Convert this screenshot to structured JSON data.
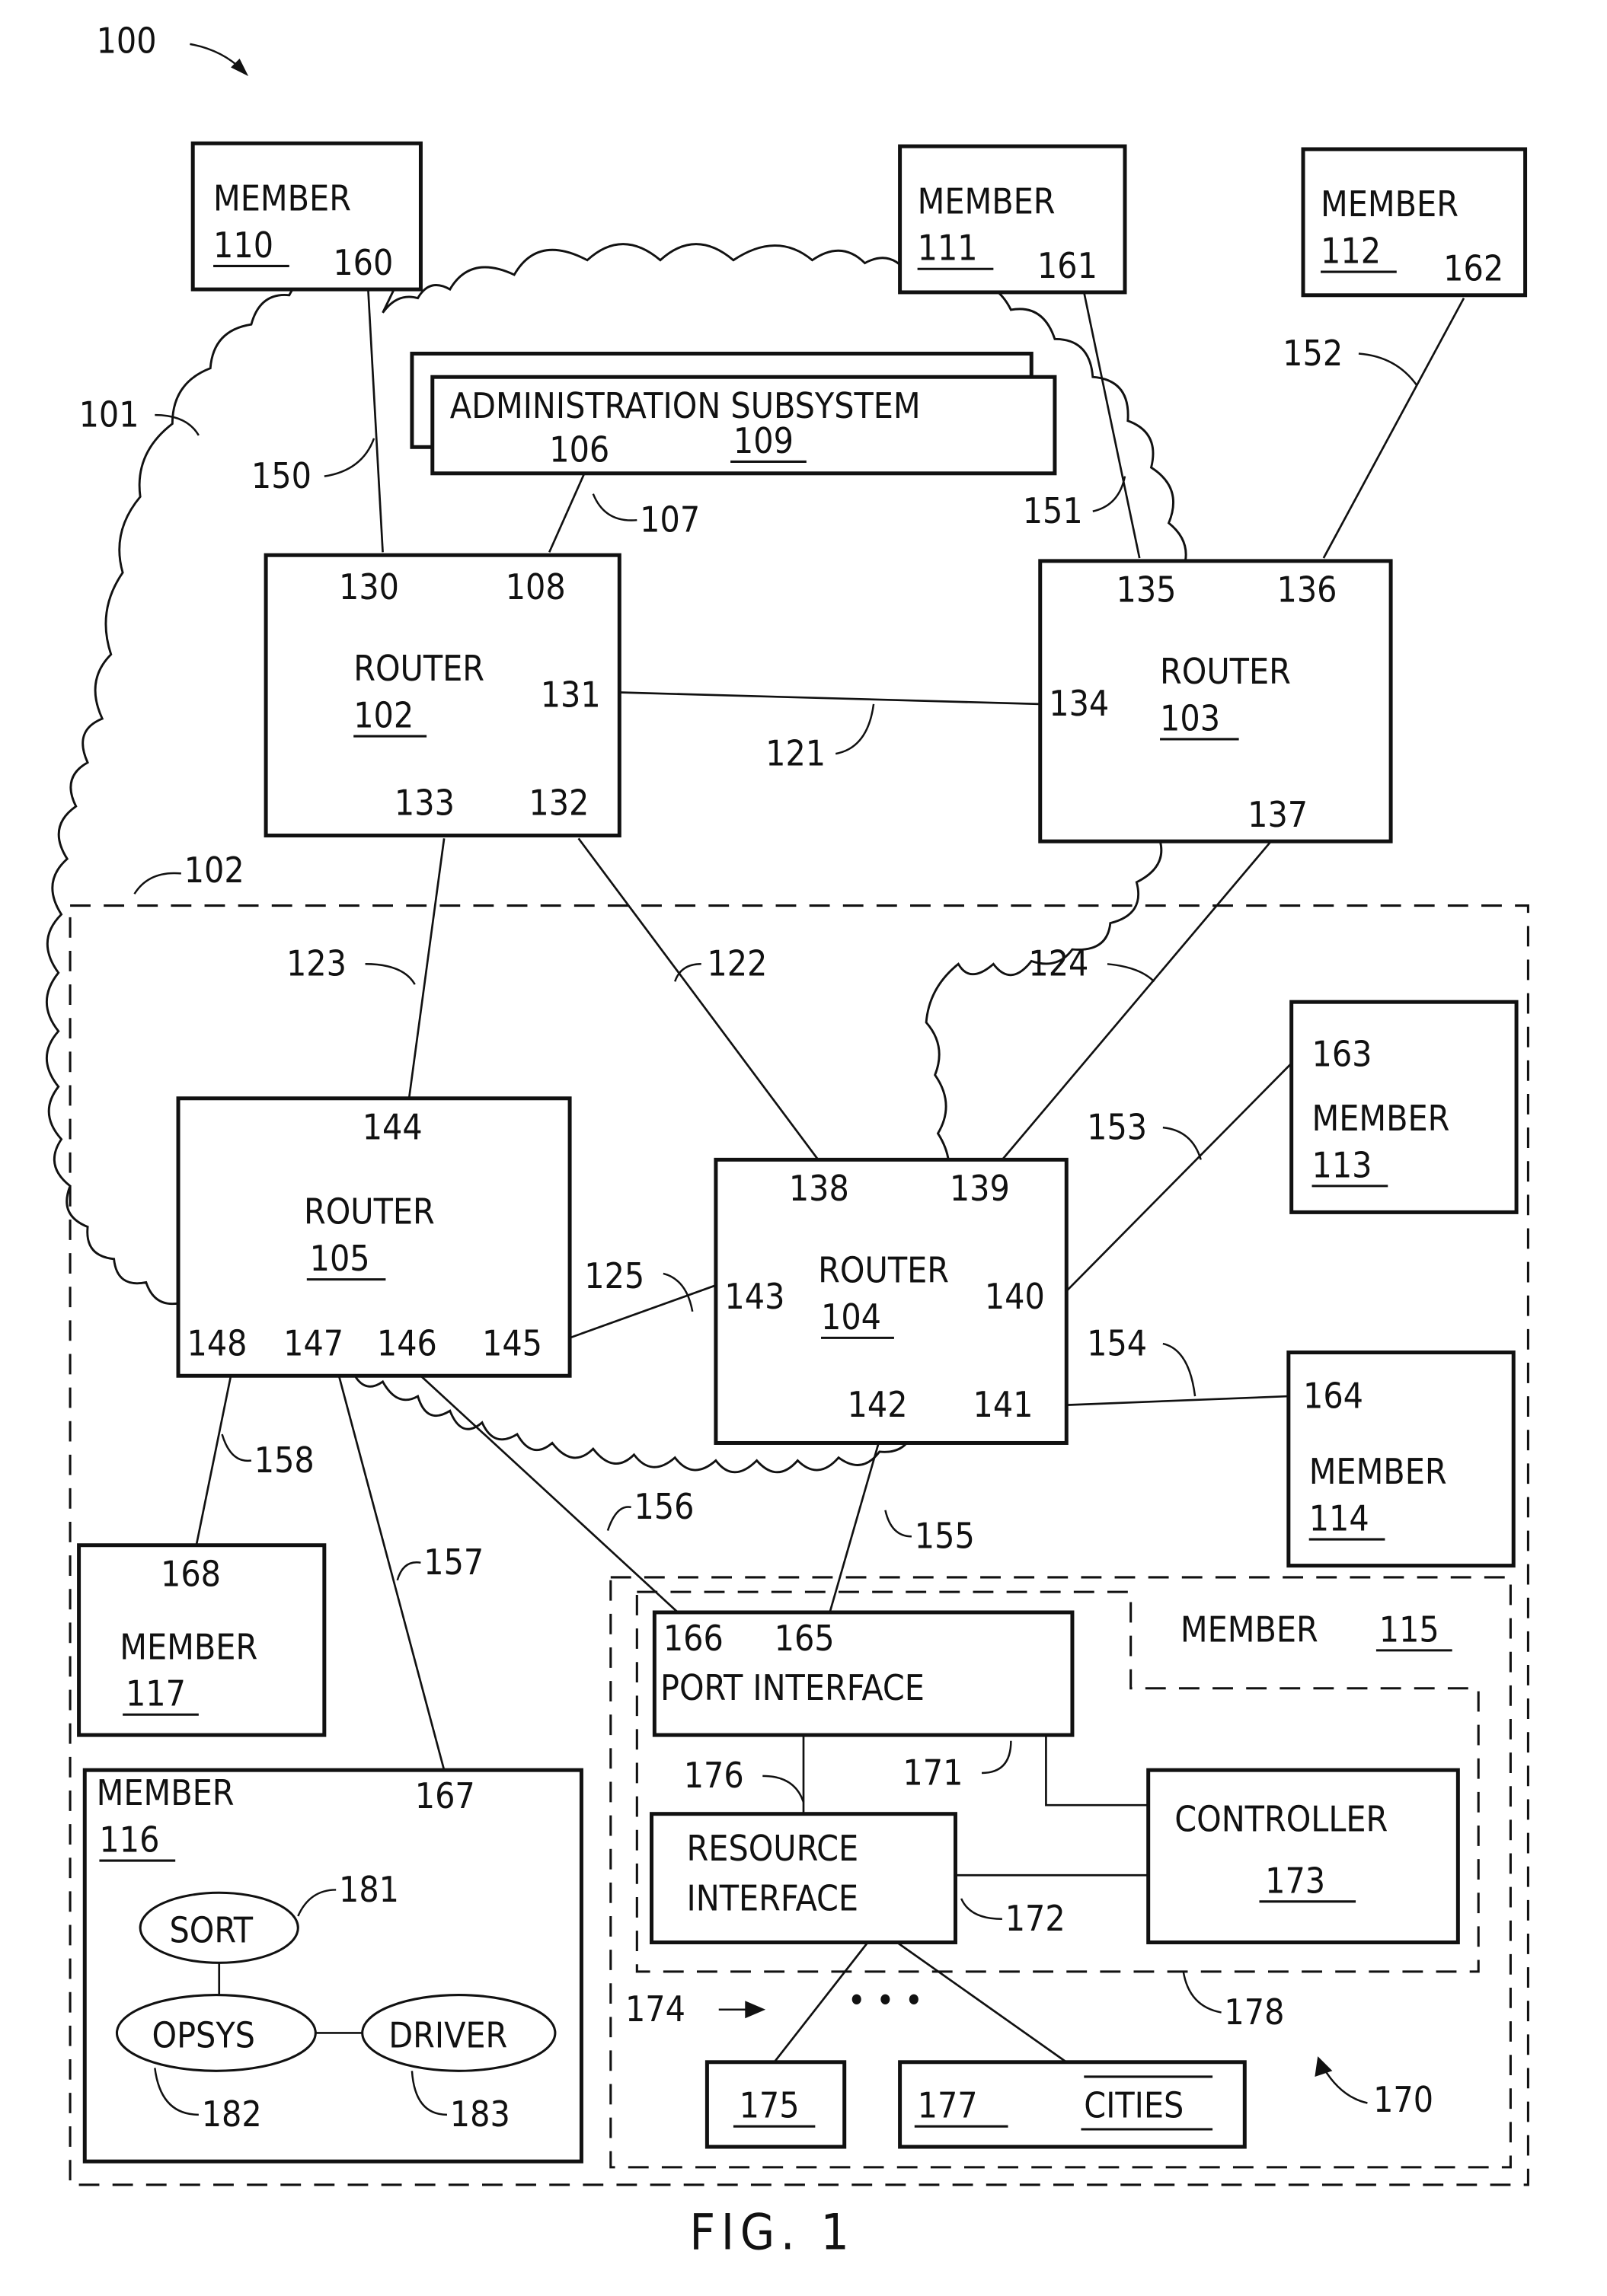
{
  "figure": {
    "caption": "FIG. 1",
    "system_ref": "100",
    "network_ref": "101",
    "domain_ref": "102"
  },
  "admin": {
    "title": "ADMINISTRATION  SUBSYSTEM",
    "ref_a": "106",
    "ref_b": "109",
    "link_ref": "107"
  },
  "routers": [
    {
      "label": "ROUTER",
      "id": "102",
      "ports": [
        "130",
        "108",
        "131",
        "133",
        "132"
      ]
    },
    {
      "label": "ROUTER",
      "id": "103",
      "ports": [
        "135",
        "136",
        "134",
        "137"
      ]
    },
    {
      "label": "ROUTER",
      "id": "104",
      "ports": [
        "138",
        "139",
        "143",
        "140",
        "142",
        "141"
      ]
    },
    {
      "label": "ROUTER",
      "id": "105",
      "ports": [
        "144",
        "148",
        "147",
        "146",
        "145"
      ]
    }
  ],
  "links": [
    "121",
    "122",
    "123",
    "124",
    "125",
    "150",
    "151",
    "152",
    "153",
    "154",
    "155",
    "156",
    "157",
    "158"
  ],
  "members": [
    {
      "label": "MEMBER",
      "id": "110",
      "port": "160"
    },
    {
      "label": "MEMBER",
      "id": "111",
      "port": "161"
    },
    {
      "label": "MEMBER",
      "id": "112",
      "port": "162"
    },
    {
      "label": "MEMBER",
      "id": "113",
      "port": "163"
    },
    {
      "label": "MEMBER",
      "id": "114",
      "port": "164"
    },
    {
      "label": "MEMBER",
      "id": "115"
    },
    {
      "label": "MEMBER",
      "id": "116",
      "port": "167"
    },
    {
      "label": "MEMBER",
      "id": "117",
      "port": "168"
    }
  ],
  "member115": {
    "port_interface": "PORT  INTERFACE",
    "port_refs": [
      "166",
      "165"
    ],
    "resource_interface_line1": "RESOURCE",
    "resource_interface_line2": "INTERFACE",
    "controller": "CONTROLLER",
    "controller_id": "173",
    "refs": {
      "r170": "170",
      "r171": "171",
      "r172": "172",
      "r174": "174",
      "r176": "176",
      "r178": "178"
    },
    "resources": [
      {
        "id": "175"
      },
      {
        "id": "177",
        "name": "CITIES"
      }
    ],
    "ellipsis": "• • •"
  },
  "member116": {
    "processes": [
      {
        "label": "SORT",
        "ref": "181"
      },
      {
        "label": "OPSYS",
        "ref": "182"
      },
      {
        "label": "DRIVER",
        "ref": "183"
      }
    ]
  }
}
